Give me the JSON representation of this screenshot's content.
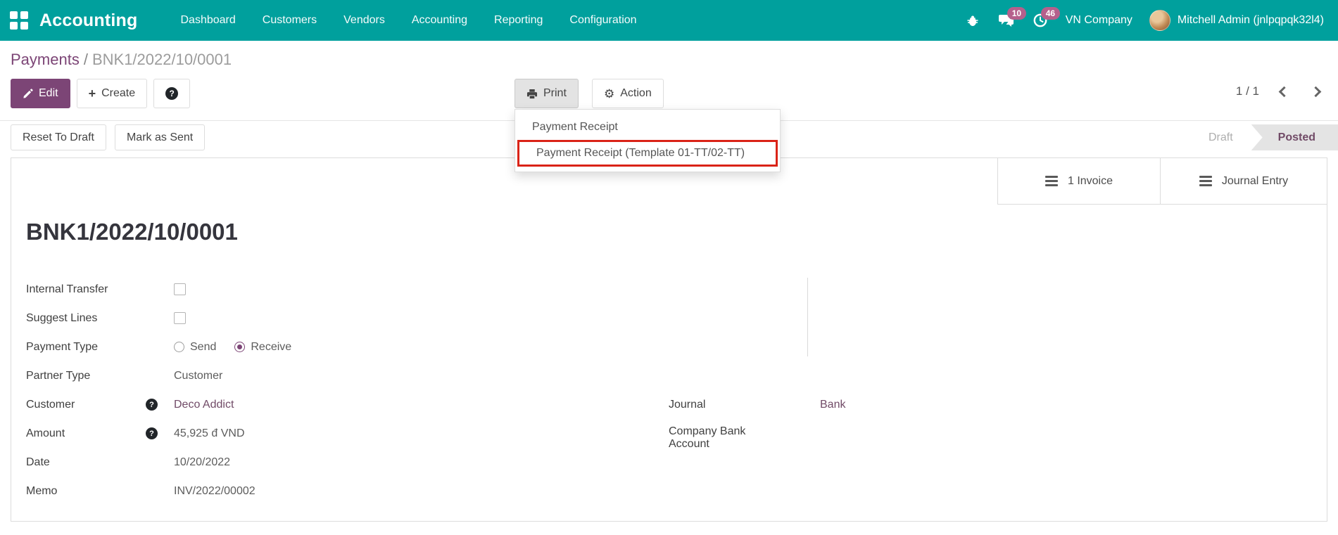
{
  "colors": {
    "navbar_bg": "#00a09d",
    "primary_purple": "#7c4576",
    "link_purple": "#714b67",
    "badge_pink": "#b5608c",
    "highlight_red": "#da2317"
  },
  "navbar": {
    "brand": "Accounting",
    "menu_items": [
      "Dashboard",
      "Customers",
      "Vendors",
      "Accounting",
      "Reporting",
      "Configuration"
    ],
    "icons": [
      "apps-grid-icon",
      "bug-icon",
      "messages-icon",
      "activities-icon"
    ],
    "messages_badge": "10",
    "activities_badge": "46",
    "company": "VN Company",
    "user": "Mitchell Admin (jnlpqpqk32l4)"
  },
  "breadcrumb": {
    "parent": "Payments",
    "separator": "/",
    "current": "BNK1/2022/10/0001"
  },
  "control_panel": {
    "edit_label": "Edit",
    "create_label": "Create",
    "print_label": "Print",
    "action_label": "Action",
    "pager": "1 / 1"
  },
  "print_menu": {
    "items": [
      {
        "label": "Payment Receipt",
        "highlighted": false
      },
      {
        "label": "Payment Receipt (Template 01-TT/02-TT)",
        "highlighted": true
      }
    ]
  },
  "status_buttons": {
    "reset": "Reset To Draft",
    "mark": "Mark as Sent"
  },
  "statusbar": {
    "stages": [
      {
        "label": "Draft",
        "active": false
      },
      {
        "label": "Posted",
        "active": true
      }
    ]
  },
  "sheet": {
    "stat_buttons": [
      {
        "label": "1 Invoice"
      },
      {
        "label": "Journal Entry"
      }
    ],
    "title": "BNK1/2022/10/0001",
    "fields_left": [
      {
        "label": "Internal Transfer",
        "type": "checkbox",
        "checked": false
      },
      {
        "label": "Suggest Lines",
        "type": "checkbox",
        "checked": false
      },
      {
        "label": "Payment Type",
        "type": "radio",
        "options": [
          {
            "label": "Send",
            "selected": false
          },
          {
            "label": "Receive",
            "selected": true
          }
        ]
      },
      {
        "label": "Partner Type",
        "type": "text",
        "value": "Customer"
      },
      {
        "label": "Customer",
        "type": "link",
        "value": "Deco Addict",
        "help": true
      },
      {
        "label": "Amount",
        "type": "text",
        "value": "45,925 đ VND",
        "help": true
      },
      {
        "label": "Date",
        "type": "text",
        "value": "10/20/2022"
      },
      {
        "label": "Memo",
        "type": "text",
        "value": "INV/2022/00002"
      }
    ],
    "fields_right": [
      {
        "label": "Journal",
        "type": "link",
        "value": "Bank"
      },
      {
        "label": "Company Bank Account",
        "type": "text",
        "value": ""
      }
    ]
  }
}
